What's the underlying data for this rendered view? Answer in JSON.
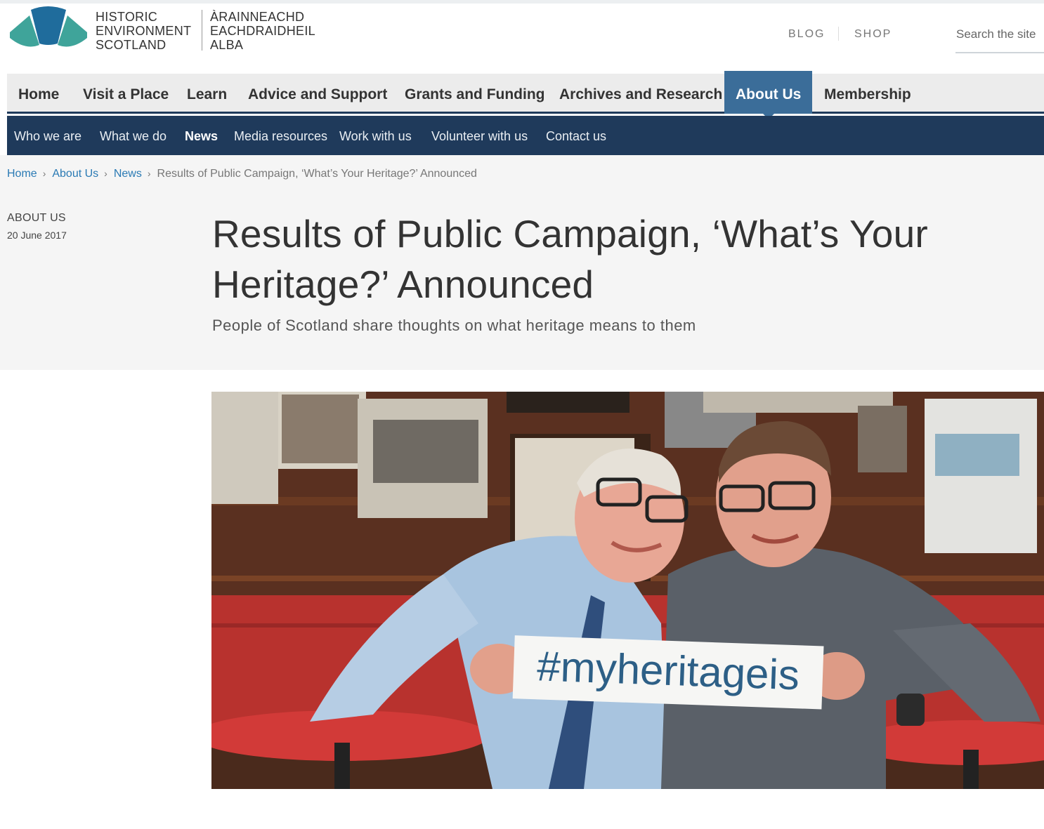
{
  "brand": {
    "english": [
      "HISTORIC",
      "ENVIRONMENT",
      "SCOTLAND"
    ],
    "gaelic": [
      "ÀRAINNEACHD",
      "EACHDRAIDHEIL",
      "ALBA"
    ],
    "colors": {
      "teal": "#3fa49a",
      "blue": "#1f6c9c"
    }
  },
  "utility_nav": {
    "blog": "BLOG",
    "shop": "SHOP"
  },
  "search": {
    "placeholder": "Search the site"
  },
  "primary_nav": [
    {
      "label": "Home"
    },
    {
      "label": "Visit a Place"
    },
    {
      "label": "Learn"
    },
    {
      "label": "Advice and Support"
    },
    {
      "label": "Grants and Funding"
    },
    {
      "label": "Archives and Research"
    },
    {
      "label": "About Us",
      "active": true
    },
    {
      "label": "Membership"
    }
  ],
  "secondary_nav": [
    {
      "label": "Who we are"
    },
    {
      "label": "What we do"
    },
    {
      "label": "News",
      "active": true
    },
    {
      "label": "Media resources"
    },
    {
      "label": "Work with us"
    },
    {
      "label": "Volunteer with us"
    },
    {
      "label": "Contact us"
    }
  ],
  "breadcrumb": {
    "items": [
      "Home",
      "About Us",
      "News"
    ],
    "current": "Results of Public Campaign, ‘What’s Your Heritage?’ Announced",
    "separator": "›"
  },
  "article": {
    "section": "ABOUT US",
    "date": "20 June 2017",
    "title": "Results of Public Campaign, ‘What’s Your Heritage?’ Announced",
    "subtitle": "People of Scotland share thoughts on what heritage means to them"
  },
  "photo": {
    "sign_text": "#myheritageis",
    "colors": {
      "seat": "#b8322e",
      "wall": "#5a2f1f",
      "table": "#d23a38"
    }
  }
}
